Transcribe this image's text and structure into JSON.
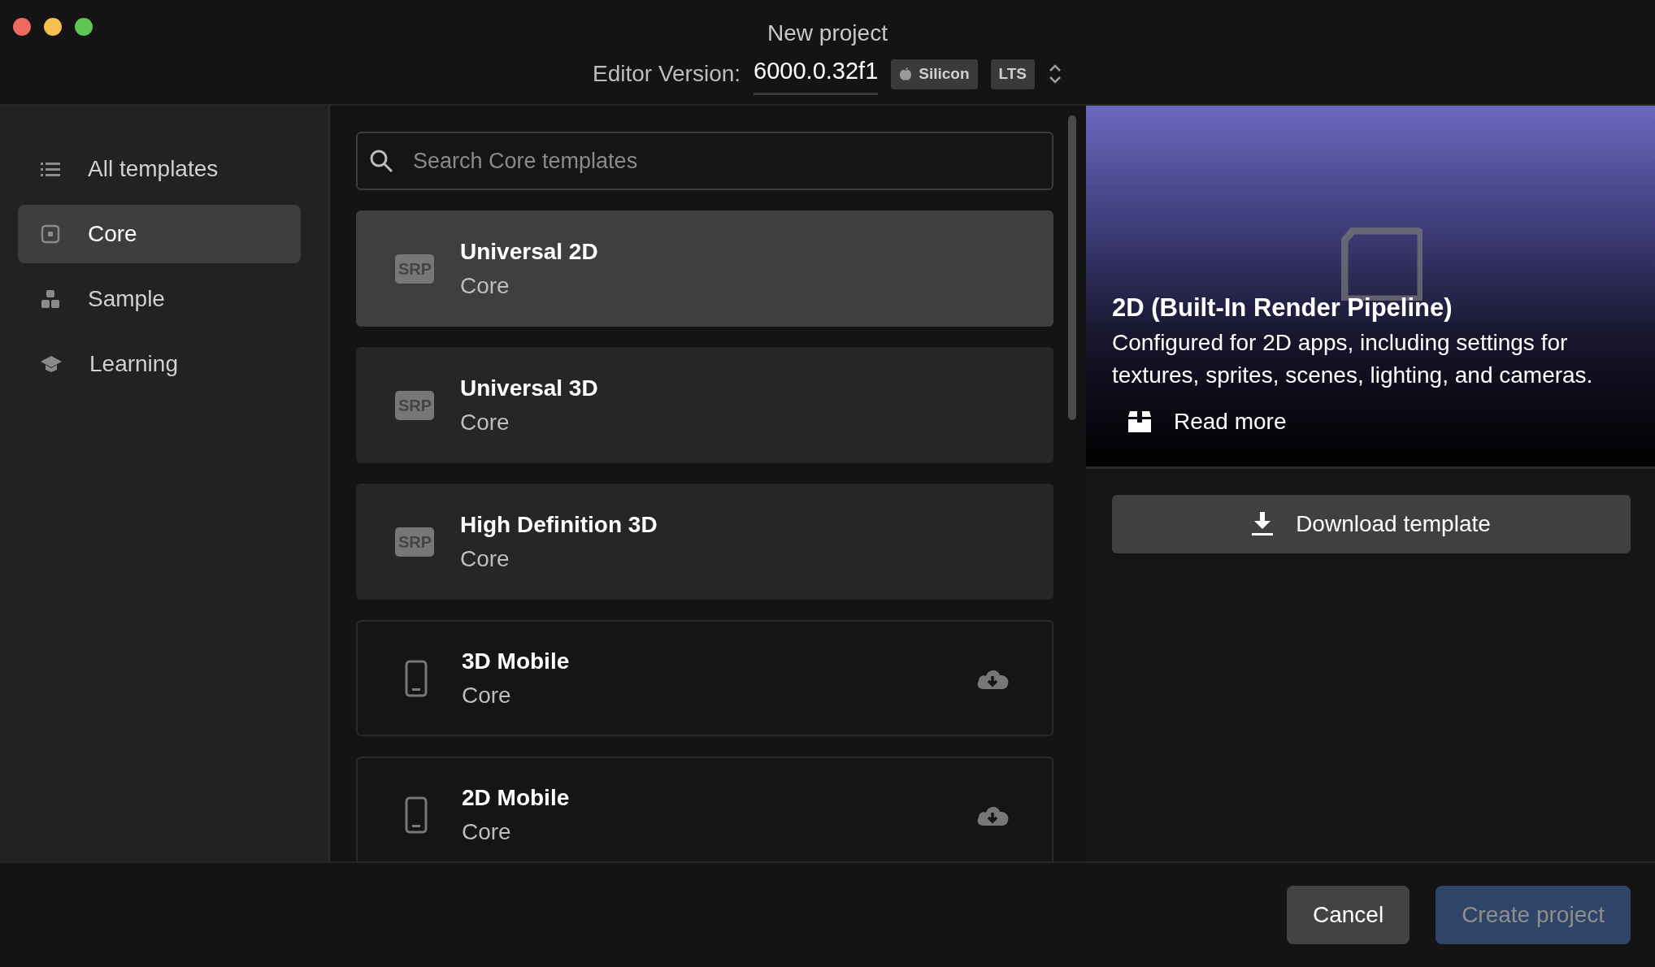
{
  "window": {
    "title": "New project"
  },
  "editor_version": {
    "label": "Editor Version:",
    "value": "6000.0.32f1",
    "chips": [
      {
        "kind": "platform",
        "text": "Silicon"
      },
      {
        "kind": "plain",
        "text": "LTS"
      }
    ]
  },
  "sidebar": {
    "items": [
      {
        "kind": "list",
        "label": "All templates",
        "selected": false
      },
      {
        "kind": "core",
        "label": "Core",
        "selected": true
      },
      {
        "kind": "sample",
        "label": "Sample",
        "selected": false
      },
      {
        "kind": "learning",
        "label": "Learning",
        "selected": false
      }
    ]
  },
  "search": {
    "placeholder": "Search Core templates"
  },
  "templates": [
    {
      "kind": "srp",
      "icon_text": "SRP",
      "title": "Universal 2D",
      "subtitle": "Core",
      "selected": true
    },
    {
      "kind": "srp",
      "icon_text": "SRP",
      "title": "Universal 3D",
      "subtitle": "Core",
      "selected": false
    },
    {
      "kind": "srp",
      "icon_text": "SRP",
      "title": "High Definition 3D",
      "subtitle": "Core",
      "selected": false
    },
    {
      "kind": "mobile",
      "title": "3D Mobile",
      "subtitle": "Core",
      "selected": false
    },
    {
      "kind": "mobile",
      "title": "2D Mobile",
      "subtitle": "Core",
      "selected": false
    }
  ],
  "preview": {
    "title": "2D (Built-In Render Pipeline)",
    "description": "Configured for 2D apps, including settings for textures, sprites, scenes, lighting, and cameras.",
    "link": "Read more",
    "action": "Download template"
  },
  "footer": {
    "buttons": [
      {
        "kind": "secondary",
        "label": "Cancel",
        "disabled": false
      },
      {
        "kind": "primary",
        "label": "Create project",
        "disabled": true
      }
    ]
  }
}
